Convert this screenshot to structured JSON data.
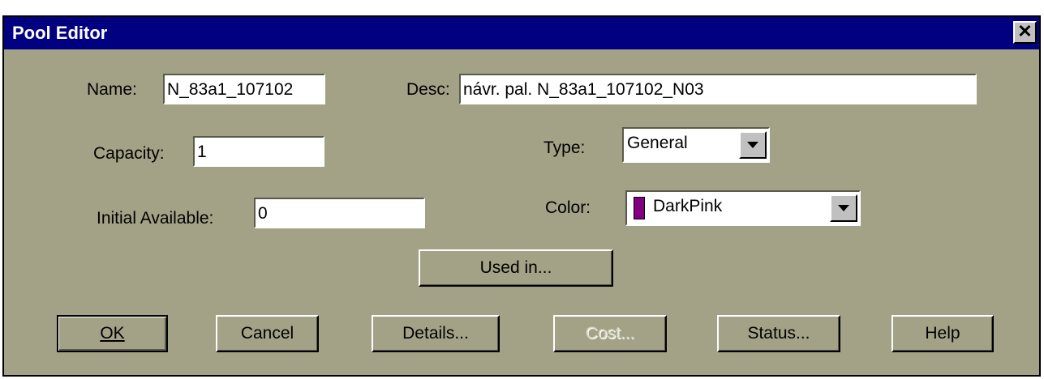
{
  "dialog": {
    "title": "Pool Editor",
    "close_label": "✕"
  },
  "fields": {
    "name_label": "Name:",
    "name_value": "N_83a1_107102",
    "desc_label": "Desc:",
    "desc_value": "návr. pal.  N_83a1_107102_N03",
    "capacity_label": "Capacity:",
    "capacity_value": "1",
    "initial_label": "Initial Available:",
    "initial_value": "0",
    "type_label": "Type:",
    "type_value": "General",
    "color_label": "Color:",
    "color_value": "DarkPink",
    "color_swatch": "#800080"
  },
  "buttons": {
    "used_in": "Used in...",
    "ok": "OK",
    "cancel": "Cancel",
    "details": "Details...",
    "cost": "Cost...",
    "status": "Status...",
    "help": "Help"
  },
  "colors": {
    "dialog_bg": "#a3a287",
    "titlebar": "#000080"
  }
}
